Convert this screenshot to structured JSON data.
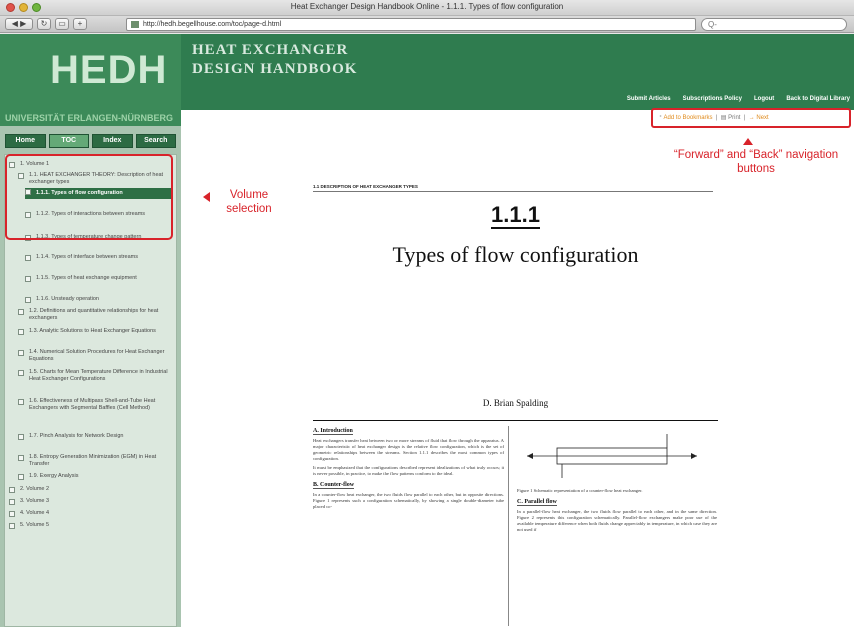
{
  "window": {
    "title": "Heat Exchanger Design Handbook Online - 1.1.1. Types of flow configuration"
  },
  "toolbar": {
    "url": "http://hedh.begellhouse.com/toc/page-d.html",
    "search_placeholder": "Q-"
  },
  "header": {
    "logo": "HEDH",
    "title_line1": "HEAT EXCHANGER",
    "title_line2": "DESIGN HANDBOOK",
    "nav": [
      "Submit Articles",
      "Subscriptions Policy",
      "Logout",
      "Back to Digital Library"
    ]
  },
  "sidebar": {
    "subscriber": "UNIVERSITÄT ERLANGEN-NÜRNBERG",
    "tabs": [
      "Home",
      "TOC",
      "Index",
      "Search"
    ],
    "active_tab": "TOC",
    "toc": [
      {
        "label": "1. Volume 1"
      },
      {
        "label": "1.1. HEAT EXCHANGER THEORY: Description of heat exchanger types"
      },
      {
        "label": "1.1.1. Types of flow configuration",
        "selected": true
      },
      {
        "label": "1.1.2. Types of interactions between streams"
      },
      {
        "label": "1.1.3. Types of temperature change pattern"
      },
      {
        "label": "1.1.4. Types of interface between streams"
      },
      {
        "label": "1.1.5. Types of heat exchange equipment"
      },
      {
        "label": "1.1.6. Unsteady operation"
      },
      {
        "label": "1.2. Definitions and quantitative relationships for heat exchangers"
      },
      {
        "label": "1.3. Analytic Solutions to Heat Exchanger Equations"
      },
      {
        "label": "1.4. Numerical Solution Procedures for Heat Exchanger Equations"
      },
      {
        "label": "1.5. Charts for Mean Temperature Difference in Industrial Heat Exchanger Configurations"
      },
      {
        "label": "1.6. Effectiveness of Multipass Shell-and-Tube Heat Exchangers with Segmental Baffles (Cell Method)"
      },
      {
        "label": "1.7. Pinch Analysis for Network Design"
      },
      {
        "label": "1.8. Entropy Generation Minimization (EGM) in Heat Transfer"
      },
      {
        "label": "1.9. Exergy Analysis"
      },
      {
        "label": "2. Volume 2"
      },
      {
        "label": "3. Volume 3"
      },
      {
        "label": "4. Volume 4"
      },
      {
        "label": "5. Volume 5"
      }
    ]
  },
  "content": {
    "tools": {
      "bookmark": "Add to Bookmarks",
      "print": "Print",
      "next": "Next"
    },
    "annotation_right": "“Forward” and “Back” navigation buttons",
    "annotation_left": "Volume selection",
    "section_head": "1.1 DESCRIPTION OF HEAT EXCHANGER TYPES",
    "section_number": "1.1.1",
    "section_title": "Types of flow configuration",
    "author": "D. Brian Spalding",
    "intro_heading": "A. Introduction",
    "intro_p1": "Heat exchangers transfer heat between two or more streams of fluid that flow through the apparatus. A major characteristic of heat exchanger design is the relative flow configuration, which is the set of geometric relationships between the streams. Section 1.1.1 describes the most common types of configuration.",
    "intro_p2": "It must be emphasized that the configurations described represent idealizations of what truly occurs; it is never possible, in practice, to make the flow patterns conform to the ideal.",
    "counterflow_heading": "B. Counter-flow",
    "counterflow_p": "In a counter-flow heat exchanger, the two fluids flow parallel to each other, but in opposite directions. Figure 1 represents such a configuration schematically, by showing a single double-diameter tube placed co-",
    "figure_caption": "Figure 1 Schematic representation of a counter-flow heat exchanger.",
    "parallel_heading": "C. Parallel flow",
    "parallel_p": "In a parallel-flow heat exchanger, the two fluids flow parallel to each other, and in the same direction. Figure 2 represents this configuration schematically. Parallel-flow exchangers make poor use of the available temperature difference when both fluids change appreciably in temperature, in which case they are not used if"
  },
  "colors": {
    "header_green": "#2f7c4f",
    "accent_red": "#d8232a",
    "selected_item": "#2e6f45"
  }
}
